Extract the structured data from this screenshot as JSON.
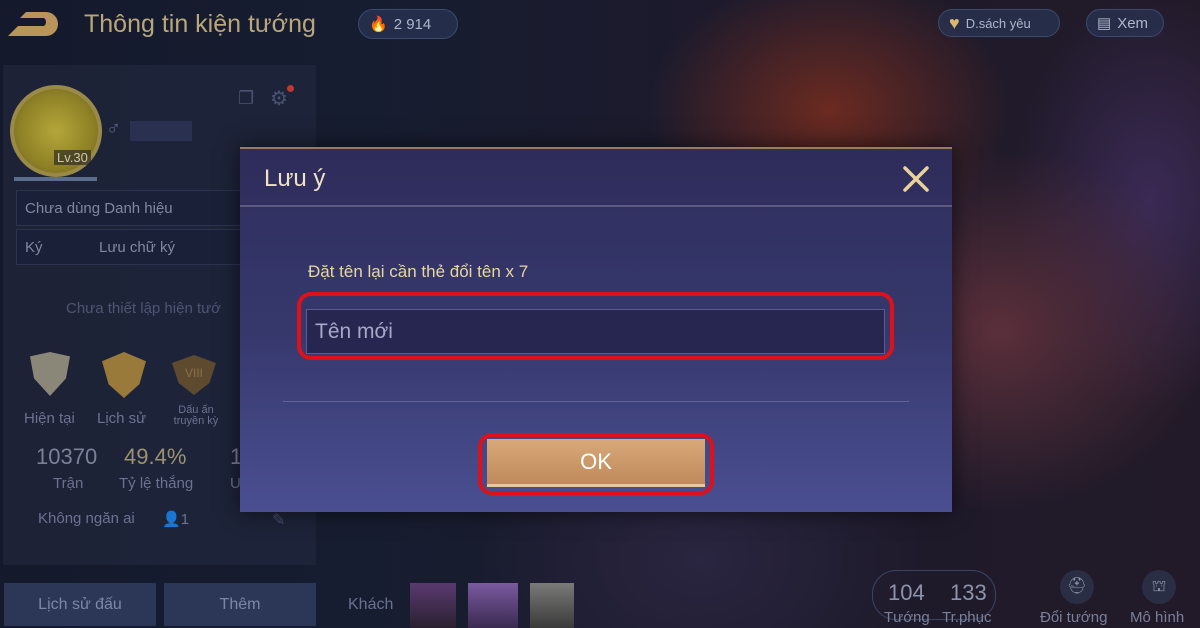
{
  "header": {
    "title": "Thông tin kiện tướng",
    "fire_count": "2 914",
    "favorites_label": "D.sách yêu",
    "view_label": "Xem"
  },
  "profile": {
    "level": "Lv.30",
    "title_row": "Chưa dùng Danh hiệu",
    "signature_label": "Ký",
    "signature_value": "Lưu chữ ký",
    "hero_placeholder": "Chưa thiết lập hiện tướ",
    "ranks": [
      {
        "label": "Hiện tại"
      },
      {
        "label": "Lịch sử"
      },
      {
        "label": "Dấu ấn truyền kỳ",
        "roman": "VIII"
      }
    ],
    "stats": [
      {
        "value": "10370",
        "label": "Trận"
      },
      {
        "value": "49.4%",
        "label": "Tỷ lệ thắng"
      },
      {
        "value": "1",
        "label": "U"
      }
    ],
    "block_label": "Không ngăn ai",
    "friend_count": "1"
  },
  "bottom": {
    "history_button": "Lịch sử đấu",
    "more_button": "Thêm",
    "guest_label": "Khách",
    "heroes_count": "104",
    "heroes_label": "Tướng",
    "skins_count": "133",
    "skins_label": "Tr.phục",
    "change_hero": "Đổi tướng",
    "model": "Mô hình"
  },
  "dialog": {
    "title": "Lưu ý",
    "message": "Đặt tên lại cần thẻ đổi tên x 7",
    "input_placeholder": "Tên mới",
    "ok_label": "OK"
  },
  "colors": {
    "highlight": "#e0101a",
    "accent_gold": "#e8d6a2",
    "ok_button": "#c99a6a"
  }
}
